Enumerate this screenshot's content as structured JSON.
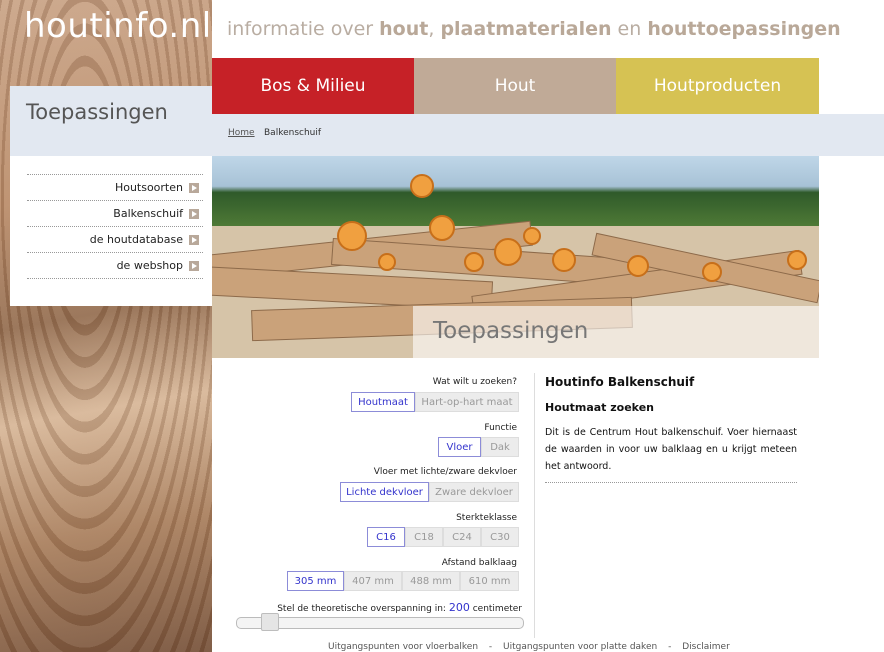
{
  "header": {
    "logo": "houtinfo.nl",
    "tagline": {
      "pre": "informatie over ",
      "w1": "hout",
      "sep1": ", ",
      "w2": "plaatmaterialen",
      "sep2": " en ",
      "w3": "houttoepassingen"
    }
  },
  "nav": {
    "tabs": [
      {
        "label": "Bos & Milieu"
      },
      {
        "label": "Hout"
      },
      {
        "label": "Houtproducten"
      }
    ]
  },
  "section": {
    "title": "Toepassingen"
  },
  "breadcrumb": {
    "home": "Home",
    "current": "Balkenschuif"
  },
  "sidebar": {
    "items": [
      {
        "label": "Houtsoorten"
      },
      {
        "label": "Balkenschuif"
      },
      {
        "label": "de houtdatabase"
      },
      {
        "label": "de webshop"
      }
    ]
  },
  "hero": {
    "title": "Toepassingen"
  },
  "form": {
    "search": {
      "label": "Wat wilt u zoeken?",
      "options": [
        "Houtmaat",
        "Hart-op-hart maat"
      ]
    },
    "function": {
      "label": "Functie",
      "options": [
        "Vloer",
        "Dak"
      ]
    },
    "floor": {
      "label": "Vloer met lichte/zware dekvloer",
      "options": [
        "Lichte dekvloer",
        "Zware dekvloer"
      ]
    },
    "strength": {
      "label": "Sterkteklasse",
      "options": [
        "C16",
        "C18",
        "C24",
        "C30"
      ]
    },
    "spacing": {
      "label": "Afstand balklaag",
      "options": [
        "305 mm",
        "407 mm",
        "488 mm",
        "610 mm"
      ]
    },
    "span": {
      "pre": "Stel de theoretische overspanning in:",
      "value": "200",
      "unit": "centimeter"
    }
  },
  "info": {
    "title": "Houtinfo Balkenschuif",
    "subtitle": "Houtmaat zoeken",
    "text": "Dit is de Centrum Hout balkenschuif. Voer hiernaast de waarden in voor uw balklaag en u krijgt meteen het antwoord."
  },
  "footer": {
    "links": [
      "Uitgangspunten voor vloerbalken",
      "Uitgangspunten voor platte daken",
      "Disclaimer"
    ],
    "sep": "-"
  }
}
